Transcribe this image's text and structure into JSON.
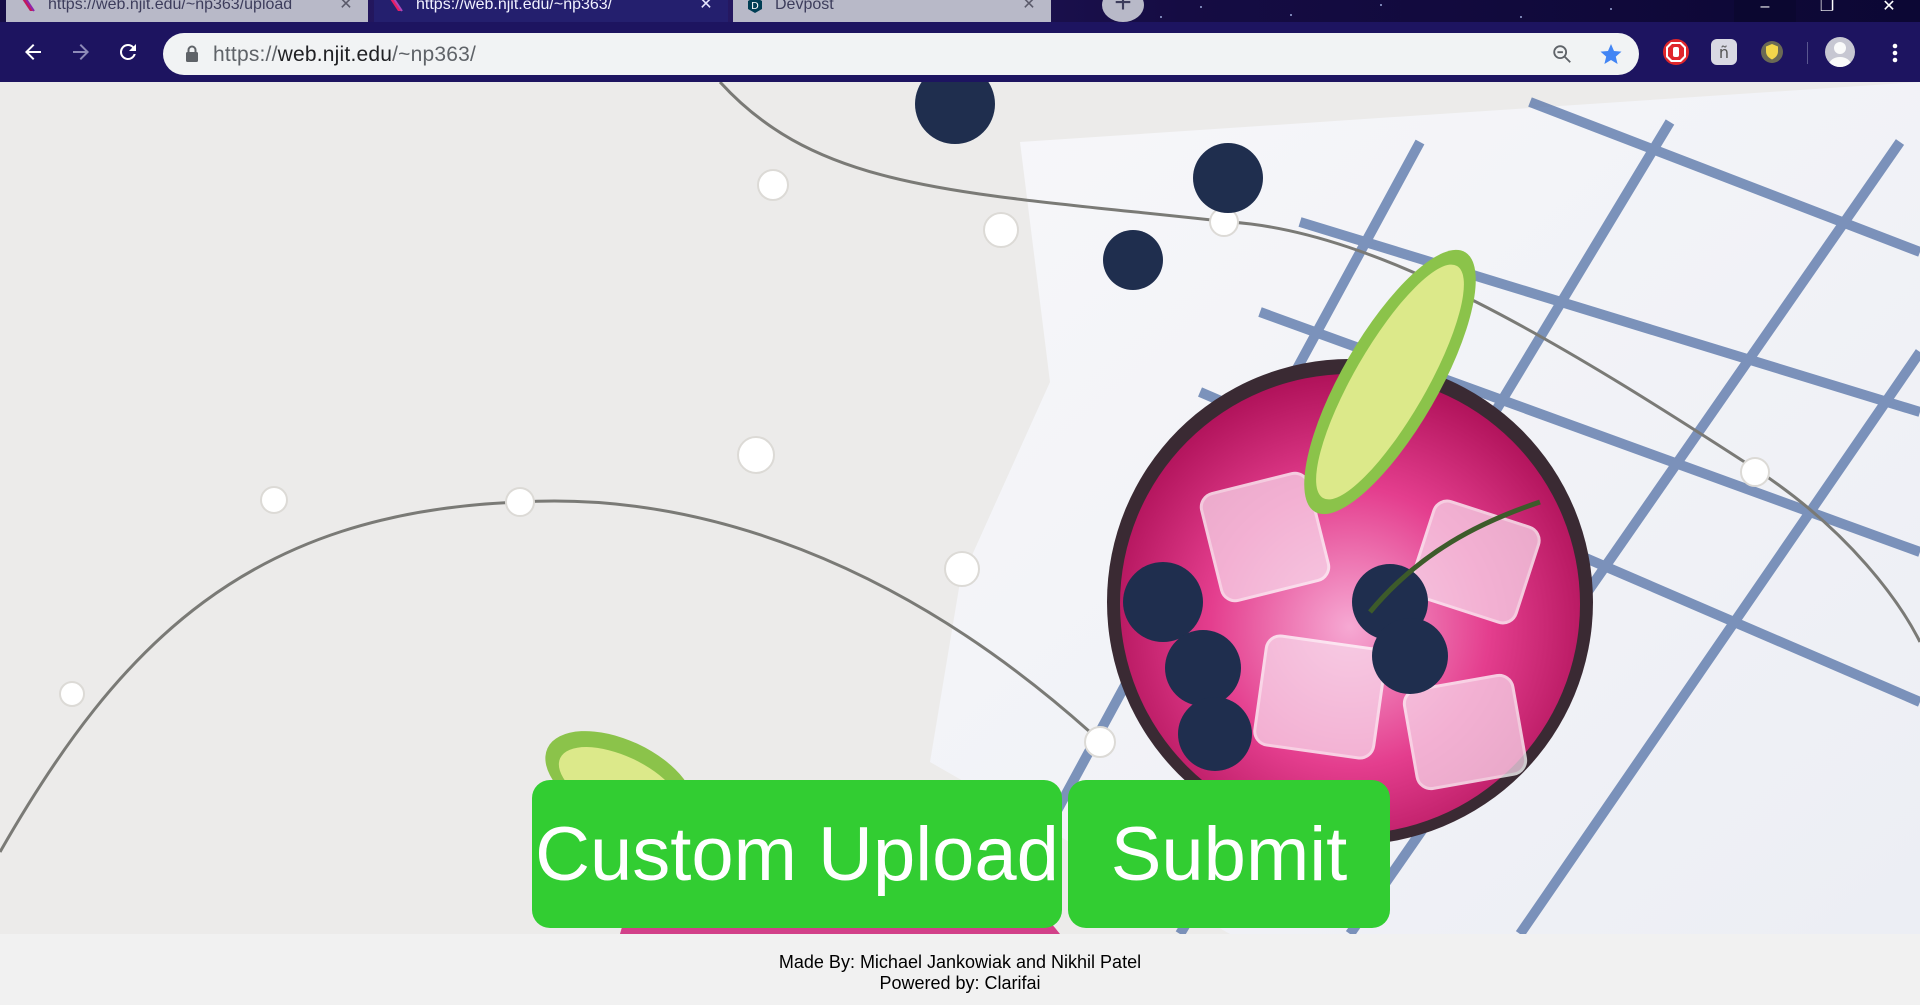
{
  "browser": {
    "tabs": [
      {
        "title": "https://web.njit.edu/~np363/upload",
        "active": false
      },
      {
        "title": "https://web.njit.edu/~np363/",
        "active": true
      },
      {
        "title": "Devpost",
        "active": false
      }
    ],
    "new_tab_icon": "plus-icon",
    "address": {
      "scheme": "https://",
      "host": "web.njit.edu",
      "path": "/~np363/"
    },
    "colors": {
      "frame": "#1d1460",
      "active_tab": "#241f6e",
      "bookmark_star": "#4285f4"
    }
  },
  "page": {
    "buttons": {
      "upload_label": "Custom Upload",
      "submit_label": "Submit"
    },
    "footer": {
      "made_by": "Made By: Michael Jankowiak and Nikhil Patel",
      "powered_by": "Powered by: Clarifai"
    },
    "colors": {
      "button_bg": "#32cd32",
      "button_text": "#ffffff",
      "footer_bg": "#f1f1f1"
    }
  }
}
